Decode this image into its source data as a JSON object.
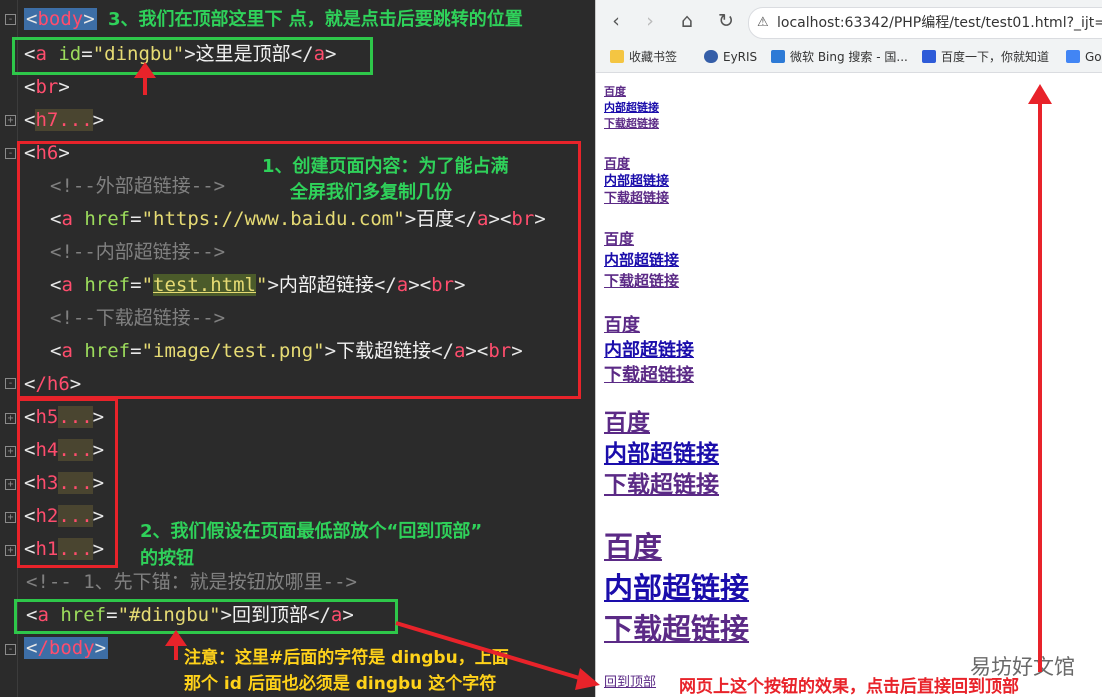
{
  "editor": {
    "lines": {
      "l1_tag": "body",
      "l2_attr": "id",
      "l2_val": "\"dingbu\"",
      "l2_text": "这里是顶部",
      "l3_tag": "br",
      "l4_tag": "h7",
      "l5_tag": "h6",
      "l6_comment": "<!--外部超链接-->",
      "l7_href": "\"https://www.baidu.com\"",
      "l7_text": "百度",
      "l8_comment": "<!--内部超链接-->",
      "l9_href": "test.html",
      "l9_text": "内部超链接",
      "l10_comment": "<!--下载超链接-->",
      "l11_href": "\"image/test.png\"",
      "l11_text": "下载超链接",
      "l12_tag": "/h6",
      "h5": "h5",
      "h4": "h4",
      "h3": "h3",
      "h2": "h2",
      "h1": "h1",
      "l18_comment": "<!-- 1、先下锚：就是按钮放哪里-->",
      "l19_href": "\"#dingbu\"",
      "l19_text": "回到顶部",
      "l20_tag": "/body",
      "collapsed": "..."
    },
    "notes": {
      "note3": "3、我们在顶部这里下 点，就是点击后要跳转的位置",
      "note1_a": "1、创建页面内容：为了能占满",
      "note1_b": "全屏我们多复制几份",
      "note2_a": "2、我们假设在页面最低部放个“回到顶部”",
      "note2_b": "的按钮",
      "caution_a": "注意：这里#后面的字符是 dingbu，上面",
      "caution_b": "那个 id 后面也必须是 dingbu 这个字符"
    }
  },
  "browser": {
    "url": "localhost:63342/PHP编程/test/test01.html?_ijt=",
    "bookmarks": [
      "收藏书签",
      "EyRIS",
      "微软 Bing 搜索 - 国...",
      "百度一下，你就知道",
      "Go"
    ],
    "links": {
      "baidu": "百度",
      "internal": "内部超链接",
      "download": "下载超链接"
    },
    "back_to_top": "回到顶部",
    "effect_note": "网页上这个按钮的效果，点击后直接回到顶部",
    "watermark": "易坊好文馆"
  },
  "colors": {
    "editor_bg": "#2b2b2b",
    "box_green": "#2ec74a",
    "box_red": "#e8232a",
    "tag_red": "#ff4d6d",
    "note_green": "#2fd15a",
    "note_yellow": "#ffd21a"
  }
}
